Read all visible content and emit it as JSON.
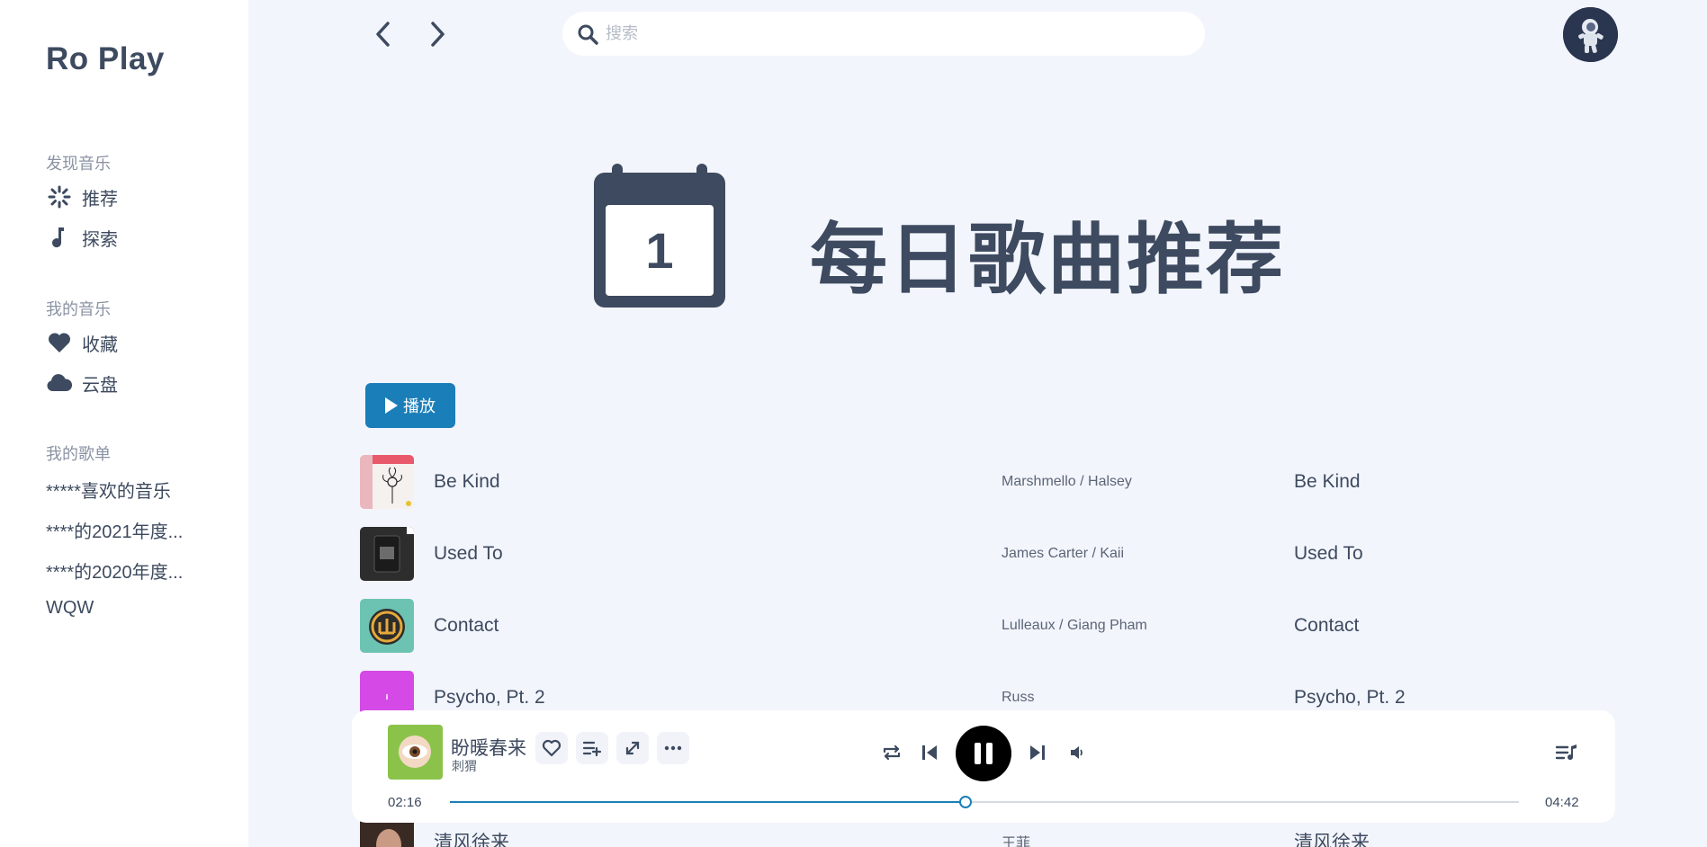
{
  "app": {
    "brand": "Ro Play"
  },
  "sidebar": {
    "discover_title": "发现音乐",
    "discover_items": [
      {
        "label": "推荐",
        "icon": "sparkle-icon"
      },
      {
        "label": "探索",
        "icon": "music-note-icon"
      }
    ],
    "my_music_title": "我的音乐",
    "my_music_items": [
      {
        "label": "收藏",
        "icon": "heart-icon"
      },
      {
        "label": "云盘",
        "icon": "cloud-icon"
      }
    ],
    "playlists_title": "我的歌单",
    "playlists": [
      "*****喜欢的音乐",
      "****的2021年度...",
      "****的2020年度...",
      "WQW"
    ]
  },
  "search": {
    "placeholder": "搜索",
    "value": ""
  },
  "hero": {
    "calendar_day": "1",
    "title": "每日歌曲推荐"
  },
  "play_button": {
    "label": "播放"
  },
  "tracks": [
    {
      "title": "Be Kind",
      "artists": "Marshmello / Halsey",
      "album": "Be Kind"
    },
    {
      "title": "Used To",
      "artists": "James Carter / Kaii",
      "album": "Used To"
    },
    {
      "title": "Contact",
      "artists": "Lulleaux / Giang Pham",
      "album": "Contact"
    },
    {
      "title": "Psycho, Pt. 2",
      "artists": "Russ",
      "album": "Psycho, Pt. 2"
    },
    {
      "title": "清风徐来",
      "artists": "王菲",
      "album": "清风徐来"
    }
  ],
  "player": {
    "title": "盼暖春来",
    "artist": "刺猬",
    "current_time": "02:16",
    "total_time": "04:42",
    "progress": 0.482
  },
  "colors": {
    "accent": "#1a7eb8",
    "text": "#3d4a5f",
    "background": "#f3f5fc"
  }
}
